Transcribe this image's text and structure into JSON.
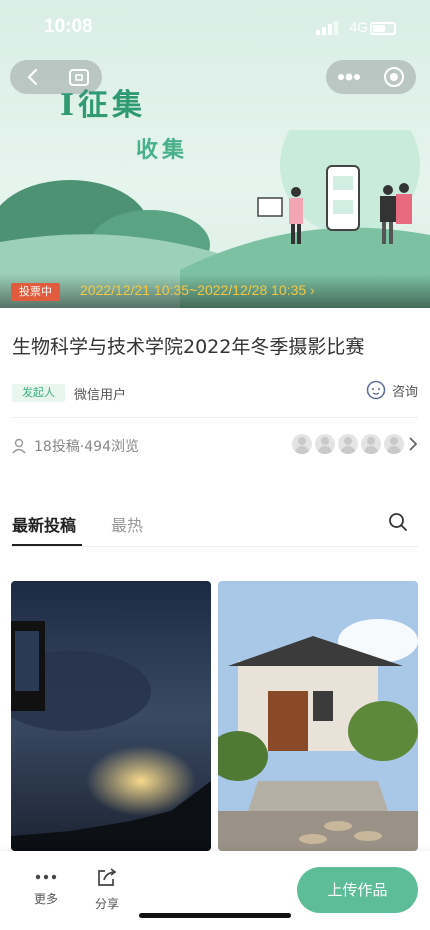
{
  "status_bar": {
    "time": "10:08",
    "network": "4G"
  },
  "banner": {
    "art_title_1": "I征集",
    "art_title_2": "收集",
    "vote_badge": "投票中",
    "vote_period": "2022/12/21 10:35~2022/12/28 10:35 ›"
  },
  "contest": {
    "title": "生物科学与技术学院2022年冬季摄影比赛",
    "organizer_tag": "发起人",
    "organizer_name": "微信用户",
    "consult_label": "咨询",
    "stats": "18投稿·494浏览"
  },
  "tabs": [
    {
      "label": "最新投稿"
    },
    {
      "label": "最热"
    }
  ],
  "bottom_bar": {
    "more_label": "更多",
    "share_label": "分享",
    "upload_label": "上传作品"
  },
  "colors": {
    "accent": "#5cbd98",
    "badge": "#e15c3f",
    "vote_time": "#f5c842"
  }
}
